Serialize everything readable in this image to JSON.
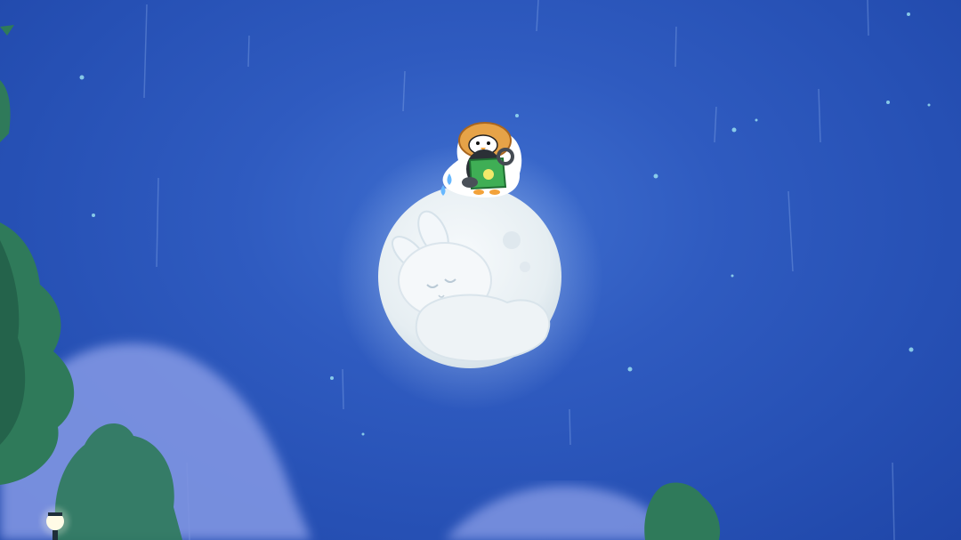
{
  "scene": {
    "sky_top": "#2a56b8",
    "sky_bottom": "#2f62c8",
    "moon_color": "#eef3f6",
    "moon_glow": "#cfe4ff",
    "hill_color": "#7f95e2",
    "tree_color": "#2f7a5a",
    "tree_dark": "#1f5a44",
    "rain_color": "#8fb1ee",
    "star_color": "#9fe6f4"
  },
  "icons": {
    "moon": "moon-with-sleeping-bunny-icon",
    "mascot": "penguin-with-watering-can-icon",
    "lamp": "street-lamp-icon"
  }
}
